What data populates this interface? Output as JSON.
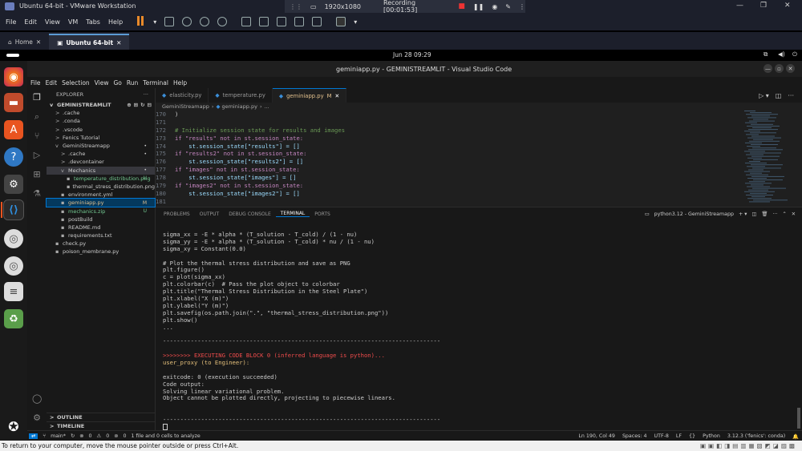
{
  "vmware": {
    "title": "Ubuntu 64-bit - VMware Workstation",
    "resolution": "1920x1080",
    "recording": "Recording [00:01:53]",
    "menu": [
      "File",
      "Edit",
      "View",
      "VM",
      "Tabs",
      "Help"
    ],
    "tabs": [
      {
        "label": "Home"
      },
      {
        "label": "Ubuntu 64-bit"
      }
    ],
    "hint": "To return to your computer, move the mouse pointer outside or press Ctrl+Alt."
  },
  "ubuntu": {
    "clock": "Jun 28  09:29"
  },
  "vscode": {
    "title": "geminiapp.py - GEMINISTREAMLIT - Visual Studio Code",
    "menu": [
      "File",
      "Edit",
      "Selection",
      "View",
      "Go",
      "Run",
      "Terminal",
      "Help"
    ],
    "explorer": {
      "header": "EXPLORER",
      "root": "GEMINISTREAMLIT",
      "items": [
        {
          "label": ".cache",
          "indent": 1,
          "chev": ">",
          "badge": ""
        },
        {
          "label": ".conda",
          "indent": 1,
          "chev": ">",
          "badge": ""
        },
        {
          "label": ".vscode",
          "indent": 1,
          "chev": ">",
          "badge": ""
        },
        {
          "label": "Fenics Tutorial",
          "indent": 1,
          "chev": ">",
          "badge": ""
        },
        {
          "label": "GeminiStreamapp",
          "indent": 1,
          "chev": "v",
          "badge": "•"
        },
        {
          "label": ".cache",
          "indent": 2,
          "chev": ">",
          "badge": "•"
        },
        {
          "label": ".devcontainer",
          "indent": 2,
          "chev": ">",
          "badge": ""
        },
        {
          "label": "Mechanics",
          "indent": 2,
          "chev": "v",
          "badge": "•"
        },
        {
          "label": "temperature_distribution.png",
          "indent": 3,
          "chev": "",
          "badge": "U"
        },
        {
          "label": "thermal_stress_distribution.png",
          "indent": 3,
          "chev": "",
          "badge": ""
        },
        {
          "label": "environment.yml",
          "indent": 2,
          "chev": "",
          "badge": ""
        },
        {
          "label": "geminiapp.py",
          "indent": 2,
          "chev": "",
          "badge": "M"
        },
        {
          "label": "mechanics.zip",
          "indent": 2,
          "chev": "",
          "badge": "U"
        },
        {
          "label": "postBuild",
          "indent": 2,
          "chev": "",
          "badge": ""
        },
        {
          "label": "README.md",
          "indent": 2,
          "chev": "",
          "badge": ""
        },
        {
          "label": "requirements.txt",
          "indent": 2,
          "chev": "",
          "badge": ""
        },
        {
          "label": "check.py",
          "indent": 1,
          "chev": "",
          "badge": ""
        },
        {
          "label": "poison_membrane.py",
          "indent": 1,
          "chev": "",
          "badge": ""
        }
      ],
      "outline": "OUTLINE",
      "timeline": "TIMELINE"
    },
    "tabs": [
      {
        "label": "elasticity.py",
        "active": false
      },
      {
        "label": "temperature.py",
        "active": false
      },
      {
        "label": "geminiapp.py",
        "badge": "M",
        "active": true
      }
    ],
    "breadcrumb": [
      "GeminiStreamapp",
      "geminiapp.py",
      "..."
    ],
    "code": [
      {
        "ln": "170",
        "text": ")"
      },
      {
        "ln": "171",
        "text": ""
      },
      {
        "ln": "172",
        "text": "# Initialize session state for results and images"
      },
      {
        "ln": "173",
        "text": "if \"results\" not in st.session_state:"
      },
      {
        "ln": "174",
        "text": "    st.session_state[\"results\"] = []"
      },
      {
        "ln": "175",
        "text": "if \"results2\" not in st.session_state:"
      },
      {
        "ln": "176",
        "text": "    st.session_state[\"results2\"] = []"
      },
      {
        "ln": "177",
        "text": "if \"images\" not in st.session_state:"
      },
      {
        "ln": "178",
        "text": "    st.session_state[\"images\"] = []"
      },
      {
        "ln": "179",
        "text": "if \"images2\" not in st.session_state:"
      },
      {
        "ln": "180",
        "text": "    st.session_state[\"images2\"] = []"
      },
      {
        "ln": "181",
        "text": ""
      }
    ],
    "panel": {
      "tabs": [
        "PROBLEMS",
        "OUTPUT",
        "DEBUG CONSOLE",
        "TERMINAL",
        "PORTS"
      ],
      "active_tab": "TERMINAL",
      "terminal_name": "python3.12 - GeminiStreamapp",
      "lines": [
        {
          "text": "sigma_xx = -E * alpha * (T_solution - T_cold) / (1 - nu)",
          "color": "#cccccc"
        },
        {
          "text": "sigma_yy = -E * alpha * (T_solution - T_cold) * nu / (1 - nu)",
          "color": "#cccccc"
        },
        {
          "text": "sigma_xy = Constant(0.0)",
          "color": "#cccccc"
        },
        {
          "text": "",
          "color": "#cccccc"
        },
        {
          "text": "# Plot the thermal stress distribution and save as PNG",
          "color": "#cccccc"
        },
        {
          "text": "plt.figure()",
          "color": "#cccccc"
        },
        {
          "text": "c = plot(sigma_xx)",
          "color": "#cccccc"
        },
        {
          "text": "plt.colorbar(c)  # Pass the plot object to colorbar",
          "color": "#cccccc"
        },
        {
          "text": "plt.title(\"Thermal Stress Distribution in the Steel Plate\")",
          "color": "#cccccc"
        },
        {
          "text": "plt.xlabel(\"X (m)\")",
          "color": "#cccccc"
        },
        {
          "text": "plt.ylabel(\"Y (m)\")",
          "color": "#cccccc"
        },
        {
          "text": "plt.savefig(os.path.join(\".\", \"thermal_stress_distribution.png\"))",
          "color": "#cccccc"
        },
        {
          "text": "plt.show()",
          "color": "#cccccc"
        },
        {
          "text": "...",
          "color": "#cccccc"
        },
        {
          "text": "",
          "color": "#cccccc"
        },
        {
          "text": "--------------------------------------------------------------------------------",
          "color": "#cccccc"
        },
        {
          "text": "",
          "color": "#cccccc"
        },
        {
          "text": ">>>>>>>> EXECUTING CODE BLOCK 0 (inferred language is python)...",
          "color": "#f14c4c"
        },
        {
          "text": "user_proxy (to Engineer):",
          "color": "#e5c07b"
        },
        {
          "text": "",
          "color": "#cccccc"
        },
        {
          "text": "exitcode: 0 (execution succeeded)",
          "color": "#cccccc"
        },
        {
          "text": "Code output:",
          "color": "#cccccc"
        },
        {
          "text": "Solving linear variational problem.",
          "color": "#cccccc"
        },
        {
          "text": "Object cannot be plotted directly, projecting to piecewise linears.",
          "color": "#cccccc"
        },
        {
          "text": "",
          "color": "#cccccc"
        },
        {
          "text": "",
          "color": "#cccccc"
        },
        {
          "text": "--------------------------------------------------------------------------------",
          "color": "#cccccc"
        }
      ]
    },
    "status": {
      "branch": "main*",
      "errors": "0",
      "warnings": "0",
      "ports": "0",
      "cells": "1 file and 0 cells to analyze",
      "position": "Ln 190, Col 49",
      "spaces": "Spaces: 4",
      "encoding": "UTF-8",
      "eol": "LF",
      "language": "Python",
      "interpreter": "3.12.3 ('fenics': conda)"
    }
  }
}
